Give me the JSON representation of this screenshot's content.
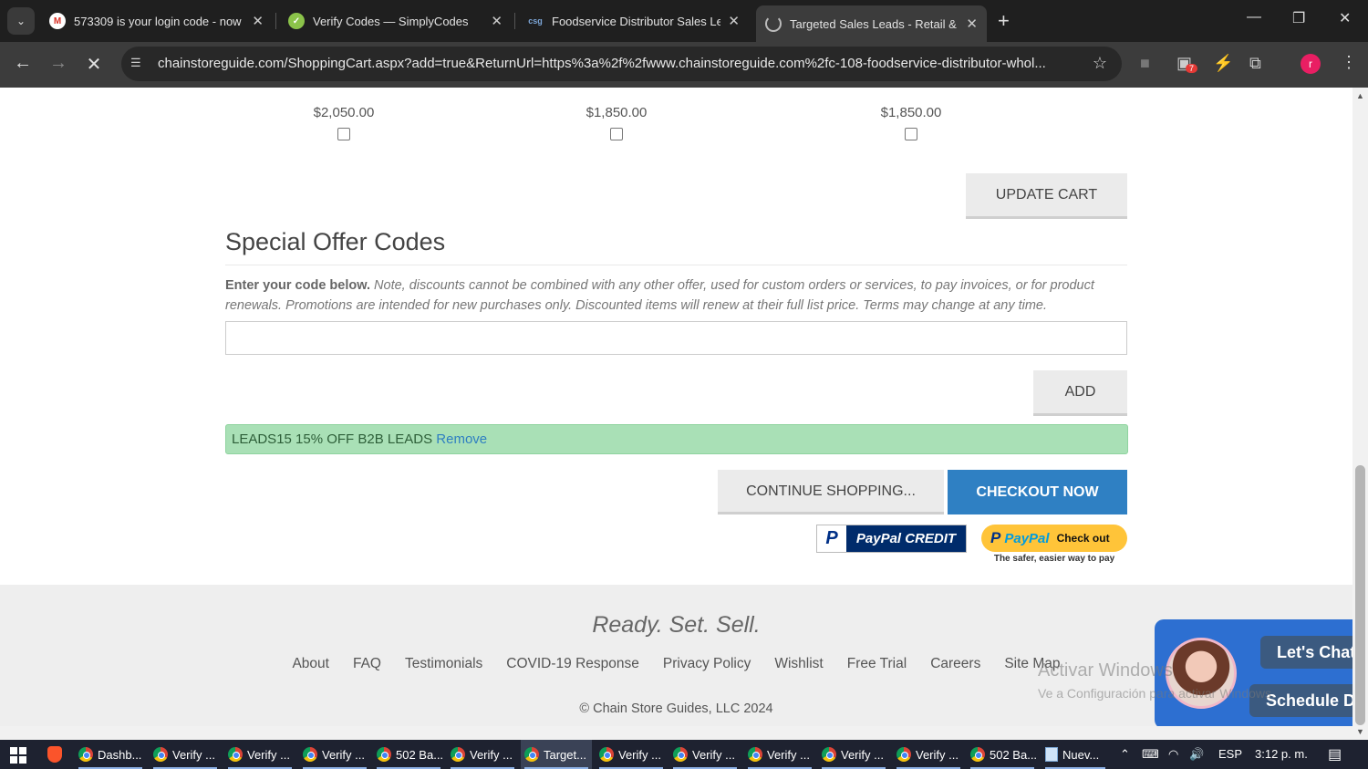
{
  "browser": {
    "tabs": [
      {
        "title": "573309 is your login code - now",
        "favicon": "gmail-icon"
      },
      {
        "title": "Verify Codes — SimplyCodes",
        "favicon": "simplycodes-icon"
      },
      {
        "title": "Foodservice Distributor Sales Le",
        "favicon": "csg-icon"
      },
      {
        "title": "Targeted Sales Leads - Retail &",
        "favicon": "loading-icon"
      }
    ],
    "url": "chainstoreguide.com/ShoppingCart.aspx?add=true&ReturnUrl=https%3a%2f%2fwww.chainstoreguide.com%2fc-108-foodservice-distributor-whol...",
    "extension_badge": "7",
    "profile_initial": "r"
  },
  "cart": {
    "prices": [
      "$2,050.00",
      "$1,850.00",
      "$1,850.00"
    ],
    "update_cart_label": "UPDATE CART"
  },
  "offer": {
    "title": "Special Offer Codes",
    "enter_label": "Enter your code below.",
    "note": "Note, discounts cannot be combined with any other offer, used for custom orders or services, to pay invoices, or for product renewals. Promotions are intended for new purchases only. Discounted items will renew at their full list price. Terms may change at any time.",
    "code_value": "",
    "add_label": "ADD",
    "applied_code": "LEADS15 15% OFF B2B LEADS",
    "remove_label": "Remove"
  },
  "actions": {
    "continue_label": "CONTINUE SHOPPING...",
    "checkout_label": "CHECKOUT NOW",
    "paypal_credit_label": "PayPal CREDIT",
    "paypal_p": "P",
    "paypal_pal": "PayPal",
    "paypal_checkout_label": "Check out",
    "paypal_tagline": "The safer, easier way to pay"
  },
  "footer": {
    "slogan": "Ready. Set. Sell.",
    "links": [
      "About",
      "FAQ",
      "Testimonials",
      "COVID-19 Response",
      "Privacy Policy",
      "Wishlist",
      "Free Trial",
      "Careers",
      "Site Map"
    ],
    "copyright": "© Chain Store Guides, LLC 2024"
  },
  "chat": {
    "chat_label": "Let's Chat",
    "demo_label": "Schedule Demo"
  },
  "watermark": {
    "line1": "Activar Windows",
    "line2": "Ve a Configuración para activar Windows."
  },
  "taskbar": {
    "items": [
      "Dashb...",
      "Verify ...",
      "Verify ...",
      "Verify ...",
      "502 Ba...",
      "Verify ...",
      "Target...",
      "Verify ...",
      "Verify ...",
      "Verify ...",
      "Verify ...",
      "Verify ...",
      "502 Ba...",
      "Nuev..."
    ],
    "language": "ESP",
    "time": "3:12 p. m."
  }
}
